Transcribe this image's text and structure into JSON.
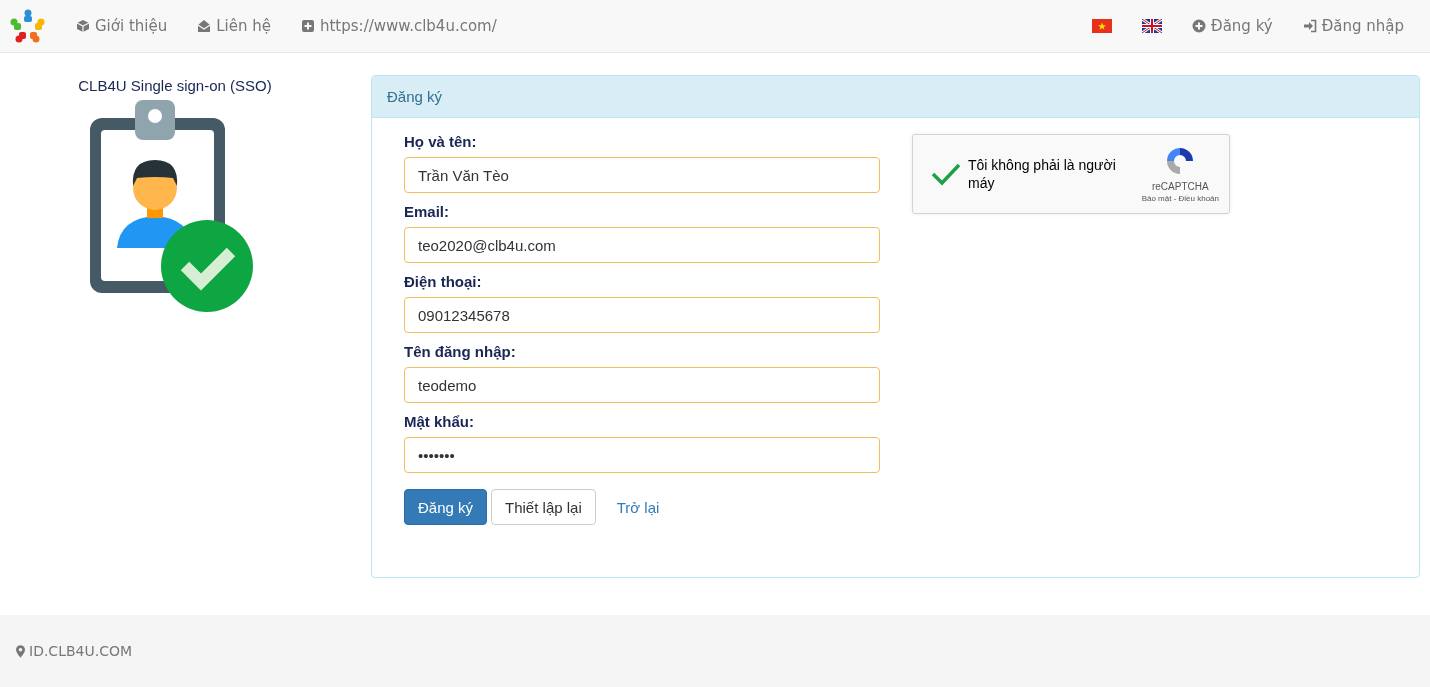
{
  "navbar": {
    "links": [
      {
        "kind": "cube",
        "label": "Giới thiệu"
      },
      {
        "kind": "envelope",
        "label": "Liên hệ"
      },
      {
        "kind": "plus",
        "label": "https://www.clb4u.com/"
      }
    ],
    "languages": [
      {
        "kind": "vietnam"
      },
      {
        "kind": "uk"
      }
    ],
    "actions": [
      {
        "kind": "plus-circle",
        "label": "Đăng ký"
      },
      {
        "kind": "login",
        "label": "Đăng nhập"
      }
    ]
  },
  "sidebar": {
    "title": "CLB4U Single sign-on (SSO)"
  },
  "panel": {
    "heading": "Đăng ký",
    "fields": [
      {
        "label": "Họ và tên:",
        "value": "Trần Văn Tèo"
      },
      {
        "label": "Email:",
        "value": "teo2020@clb4u.com"
      },
      {
        "label": "Điện thoại:",
        "value": "09012345678"
      },
      {
        "label": "Tên đăng nhập:",
        "value": "teodemo"
      },
      {
        "label": "Mật khẩu:",
        "value": "•••••••"
      }
    ],
    "buttons": [
      {
        "kind": "primary",
        "label": "Đăng ký"
      },
      {
        "kind": "default",
        "label": "Thiết lập lại"
      },
      {
        "kind": "link",
        "label": "Trở lại"
      }
    ],
    "captcha": {
      "checked": true,
      "label": "Tôi không phải là người máy",
      "brand": "reCAPTCHA",
      "links": "Bảo mật - Điều khoản"
    }
  },
  "footer": {
    "text": "ID.CLB4U.COM"
  }
}
